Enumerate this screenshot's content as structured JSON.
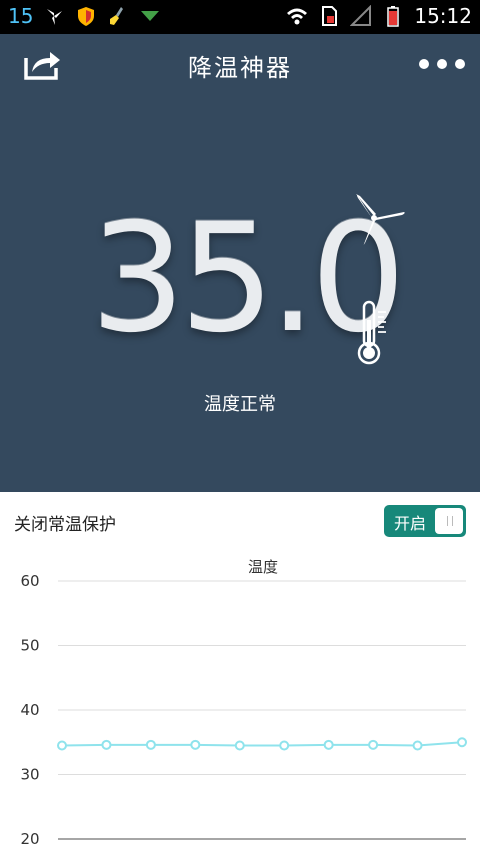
{
  "status_bar": {
    "left_number": "15",
    "icons_left": [
      "pinwheel-icon",
      "shield-icon",
      "broom-icon",
      "download-icon"
    ],
    "icons_right": [
      "wifi-icon",
      "sim-icon",
      "signal-icon",
      "battery-icon"
    ],
    "time": "15:12"
  },
  "header": {
    "title": "降温神器"
  },
  "main": {
    "temperature": "35.0",
    "status": "温度正常"
  },
  "protection": {
    "label": "关闭常温保护",
    "toggle_label": "开启"
  },
  "colors": {
    "hero_bg": "#34495e",
    "accent": "#17887a",
    "line": "#8fe3ec"
  },
  "chart_data": {
    "type": "line",
    "title": "温度",
    "ylim": [
      20,
      60
    ],
    "yticks": [
      60,
      50,
      40,
      30,
      20
    ],
    "series": [
      {
        "values": [
          34.5,
          34.6,
          34.6,
          34.6,
          34.5,
          34.5,
          34.6,
          34.6,
          34.5,
          35.0
        ]
      }
    ]
  }
}
